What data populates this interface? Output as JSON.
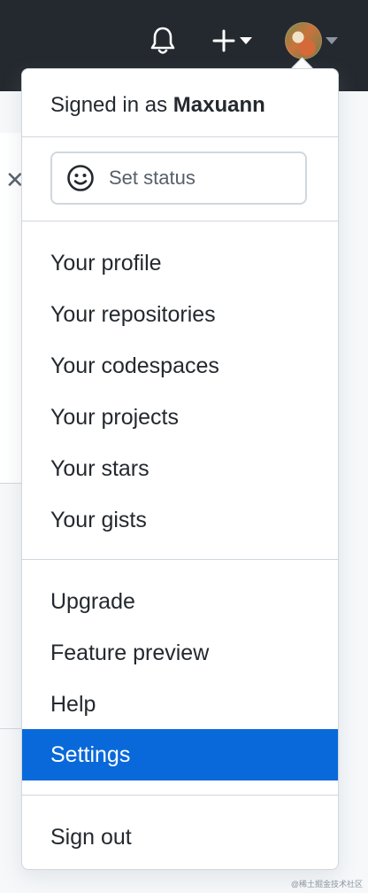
{
  "header": {
    "bell_icon": "bell-icon",
    "create_icon": "plus-icon",
    "avatar_icon": "avatar"
  },
  "dropdown": {
    "signed_in_prefix": "Signed in as",
    "username": "Maxuann",
    "set_status": "Set status",
    "section1": [
      {
        "label": "Your profile"
      },
      {
        "label": "Your repositories"
      },
      {
        "label": "Your codespaces"
      },
      {
        "label": "Your projects"
      },
      {
        "label": "Your stars"
      },
      {
        "label": "Your gists"
      }
    ],
    "section2": [
      {
        "label": "Upgrade"
      },
      {
        "label": "Feature preview"
      },
      {
        "label": "Help"
      },
      {
        "label": "Settings",
        "active": true
      }
    ],
    "sign_out": "Sign out"
  },
  "watermark": "@稀土掘金技术社区",
  "colors": {
    "header_bg": "#24292f",
    "accent": "#0969da",
    "border": "#d0d7de",
    "text": "#24292f"
  }
}
